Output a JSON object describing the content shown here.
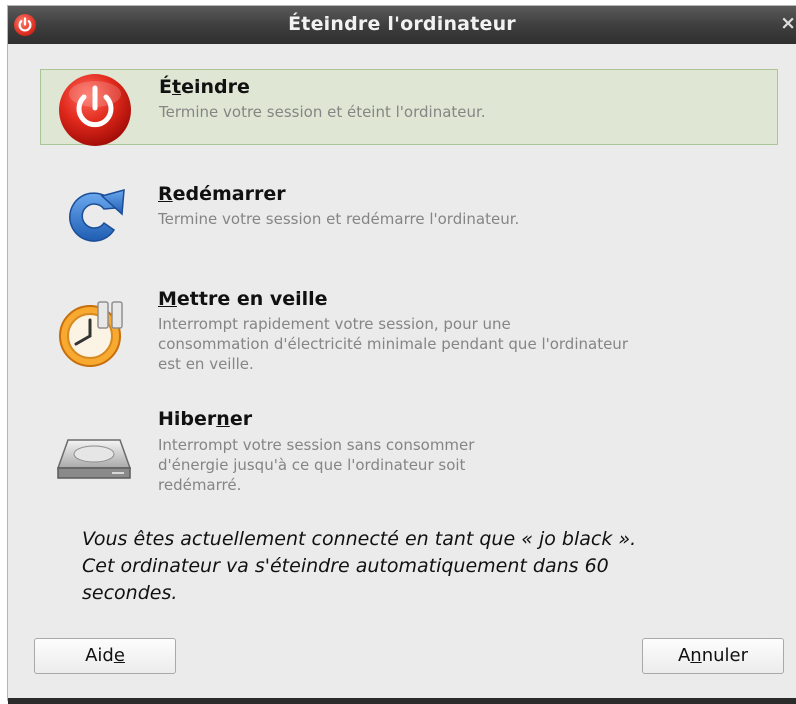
{
  "window": {
    "title": "Éteindre l'ordinateur",
    "close_glyph": "×"
  },
  "options": [
    {
      "icon": "power-icon",
      "title_pre": "É",
      "title_mnemonic": "t",
      "title_post": "eindre",
      "desc_lines": [
        "Termine votre session et éteint l'ordinateur."
      ],
      "selected": true
    },
    {
      "icon": "restart-icon",
      "title_pre": "",
      "title_mnemonic": "R",
      "title_post": "edémarrer",
      "desc_lines": [
        "Termine votre session et redémarre l'ordinateur."
      ],
      "selected": false
    },
    {
      "icon": "suspend-clock-icon",
      "title_pre": "",
      "title_mnemonic": "M",
      "title_post": "ettre en veille",
      "desc_lines": [
        "Interrompt rapidement votre session, pour  une",
        "consommation d'électricité minimale pendant que l'ordinateur",
        "est en veille."
      ],
      "selected": false
    },
    {
      "icon": "hard-disk-icon",
      "title_pre": "Hiber",
      "title_mnemonic": "n",
      "title_post": "er",
      "desc_lines": [
        "Interrompt votre session sans consommer",
        "d'énergie jusqu'à ce que l'ordinateur soit",
        "redémarré."
      ],
      "selected": false
    }
  ],
  "notice_lines": [
    "Vous êtes actuellement connecté en tant que « jo black ».",
    "Cet ordinateur va s'éteindre automatiquement dans 60",
    "secondes."
  ],
  "buttons": {
    "help_pre": "Aid",
    "help_mnemonic": "e",
    "help_post": "",
    "cancel_pre": "A",
    "cancel_mnemonic": "n",
    "cancel_post": "nuler"
  },
  "colors": {
    "selected_bg": "#dfe7d4",
    "selected_border": "#aac596",
    "power_red": "#d7261a",
    "restart_blue": "#2f73c8",
    "suspend_orange": "#f39c1f"
  }
}
